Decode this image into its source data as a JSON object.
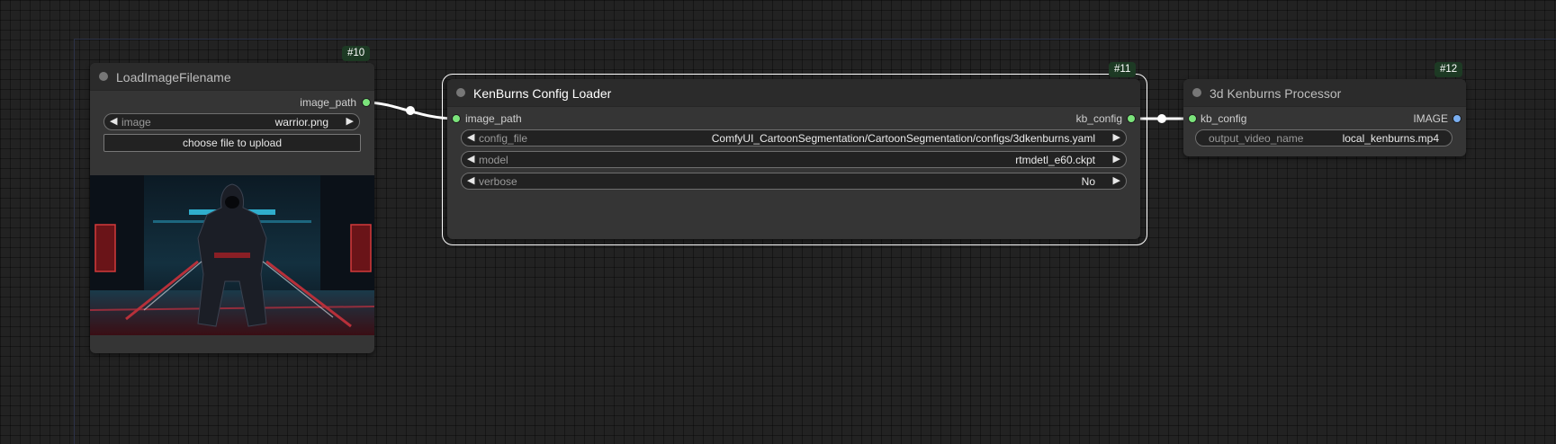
{
  "nodes": {
    "load_image": {
      "id_badge": "#10",
      "title": "LoadImageFilename",
      "outputs": [
        "image_path"
      ],
      "widgets": [
        {
          "label": "image",
          "value": "warrior.png"
        }
      ],
      "upload_label": "choose file to upload"
    },
    "kenburns_config": {
      "id_badge": "#11",
      "title": "KenBurns Config Loader",
      "inputs": [
        "image_path"
      ],
      "outputs": [
        "kb_config"
      ],
      "widgets": [
        {
          "label": "config_file",
          "value": "ComfyUI_CartoonSegmentation/CartoonSegmentation/configs/3dkenburns.yaml"
        },
        {
          "label": "model",
          "value": "rtmdetl_e60.ckpt"
        },
        {
          "label": "verbose",
          "value": "No"
        }
      ]
    },
    "kenburns_processor": {
      "id_badge": "#12",
      "title": "3d Kenburns Processor",
      "inputs": [
        "kb_config"
      ],
      "outputs": [
        "IMAGE"
      ],
      "widgets": [
        {
          "label": "output_video_name",
          "value": "local_kenburns.mp4"
        }
      ]
    }
  },
  "icons": {
    "arrow_left": "◀",
    "arrow_right": "▶",
    "preview": "warrior-image-preview"
  },
  "colors": {
    "canvas_bg": "#222222",
    "node_bg": "#353535",
    "node_title_bg": "#2b2b2b",
    "badge_bg": "#1d3a24",
    "slot_green": "#7be37b",
    "slot_blue": "#7aaef0",
    "wire": "#ffffff"
  }
}
